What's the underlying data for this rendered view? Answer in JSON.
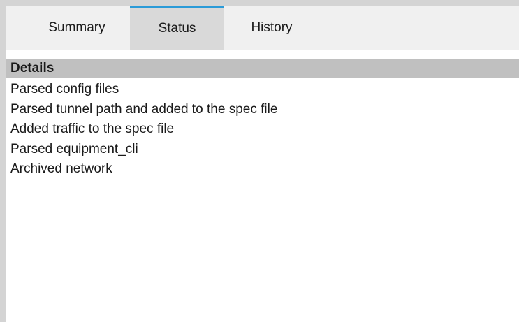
{
  "tabs": [
    {
      "label": "Summary",
      "active": false
    },
    {
      "label": "Status",
      "active": true
    },
    {
      "label": "History",
      "active": false
    }
  ],
  "details": {
    "header": "Details",
    "items": [
      "Parsed config files",
      "Parsed tunnel path and added to the spec file",
      "Added traffic to the spec file",
      "Parsed equipment_cli",
      "Archived network"
    ]
  },
  "colors": {
    "active_tab_indicator": "#2b9bd8",
    "active_tab_bg": "#d9d9d9",
    "header_bg": "#c0c0c0"
  }
}
